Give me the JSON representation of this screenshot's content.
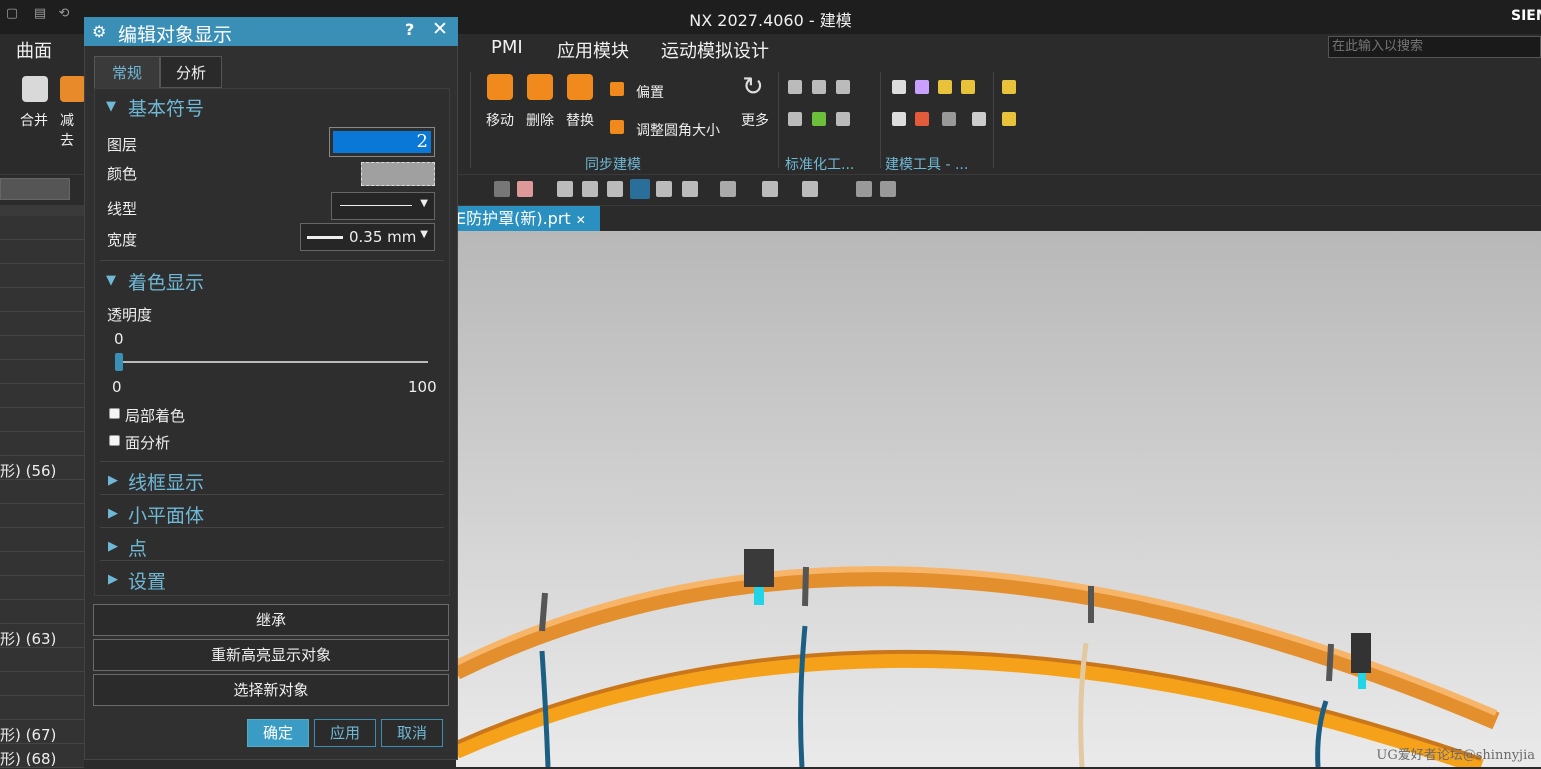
{
  "window": {
    "title": "NX 2027.4060 - 建模",
    "brand": "SIEMENS"
  },
  "menu": {
    "items": [
      "曲面",
      "PMI",
      "应用模块",
      "运动模拟设计"
    ]
  },
  "search": {
    "placeholder": "在此输入以搜索"
  },
  "ribbon": {
    "left_buttons": [
      "合并",
      "减去"
    ],
    "sync_buttons": [
      "移动",
      "删除",
      "替换"
    ],
    "offset_label": "偏置",
    "resize_blend_label": "调整圆角大小",
    "more_label": "更多",
    "groups": [
      "同步建模",
      "标准化工...",
      "建模工具 - ..."
    ]
  },
  "file_tab": {
    "label": "E防护罩(新).prt"
  },
  "nav": {
    "rows": [
      "形) (56)",
      "形) (63)",
      "形) (67)",
      "形) (68)"
    ]
  },
  "dialog": {
    "title": "编辑对象显示",
    "help": "?",
    "close": "✕",
    "tabs": [
      "常规",
      "分析"
    ],
    "sections": {
      "basic": "基本符号",
      "shading": "着色显示",
      "wireframe": "线框显示",
      "facet": "小平面体",
      "point": "点",
      "settings": "设置"
    },
    "fields": {
      "layer_label": "图层",
      "layer_value": "2",
      "color_label": "颜色",
      "color_value": "#a0a0a0",
      "linetype_label": "线型",
      "width_label": "宽度",
      "width_value": "0.35 mm",
      "transparency_label": "透明度",
      "transparency_value": "0",
      "slider_min": "0",
      "slider_max": "100",
      "transparency_fraction": 0.0,
      "partial_shading": "局部着色",
      "face_analysis": "面分析"
    },
    "actions": {
      "inherit": "继承",
      "rehighlight": "重新高亮显示对象",
      "select_new": "选择新对象"
    },
    "footer": {
      "ok": "确定",
      "apply": "应用",
      "cancel": "取消"
    }
  },
  "watermark": "UG爱好者论坛@shinnyjia",
  "colors": {
    "accent": "#3a8fb7",
    "ring": "#f5a21a",
    "highlight": "#2a90c0"
  }
}
